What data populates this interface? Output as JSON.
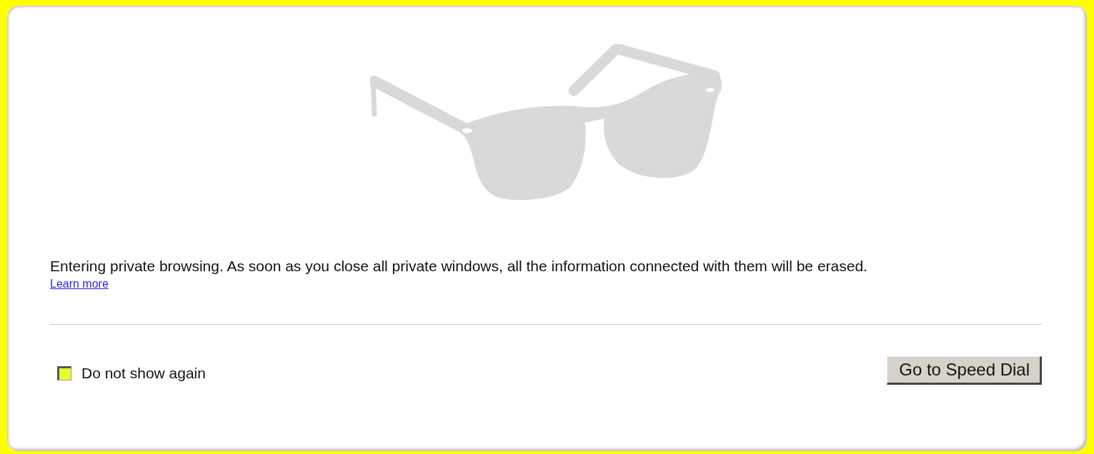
{
  "message": "Entering private browsing. As soon as you close all private windows, all the information connected with them will be erased.",
  "learn_more_link": "Learn more",
  "checkbox": {
    "label": "Do not show again",
    "checked": false
  },
  "button": "Go to Speed Dial"
}
